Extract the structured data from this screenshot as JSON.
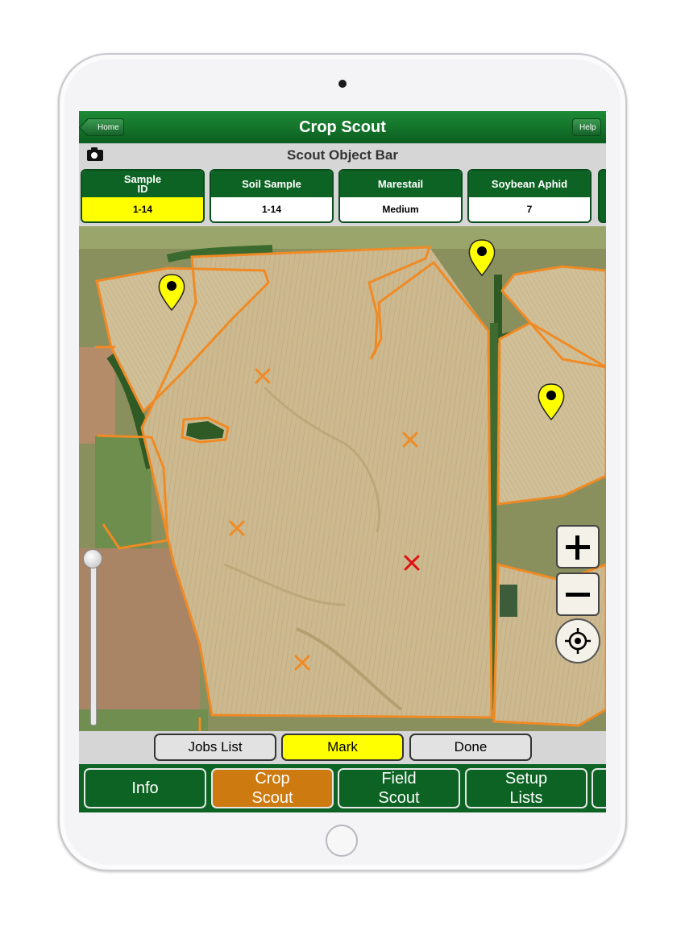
{
  "navbar": {
    "title": "Crop Scout",
    "home_label": "Home",
    "help_label": "Help"
  },
  "object_bar": {
    "title": "Scout Object Bar",
    "camera_icon": "camera-icon"
  },
  "tiles": [
    {
      "header": "Sample\nID",
      "value": "1-14",
      "active": true
    },
    {
      "header": "Soil Sample",
      "value": "1-14",
      "active": false
    },
    {
      "header": "Marestail",
      "value": "Medium",
      "active": false
    },
    {
      "header": "Soybean Aphid",
      "value": "7",
      "active": false
    }
  ],
  "map": {
    "markers": {
      "pin_color": "#ffff00",
      "x_orange": "#f08a24",
      "x_red": "#e01010",
      "boundary_color": "#f08a24"
    },
    "zoom_in_icon": "plus-icon",
    "zoom_out_icon": "minus-icon",
    "locate_icon": "crosshair-icon"
  },
  "action_bar": {
    "jobs_label": "Jobs List",
    "mark_label": "Mark",
    "done_label": "Done"
  },
  "tabs": [
    {
      "label": "Info",
      "active": false
    },
    {
      "label": "Crop\nScout",
      "active": true
    },
    {
      "label": "Field\nScout",
      "active": false
    },
    {
      "label": "Setup\nLists",
      "active": false
    }
  ],
  "colors": {
    "brand_green": "#0d6323",
    "active_tab": "#cd7a10",
    "highlight": "#ffff00"
  }
}
